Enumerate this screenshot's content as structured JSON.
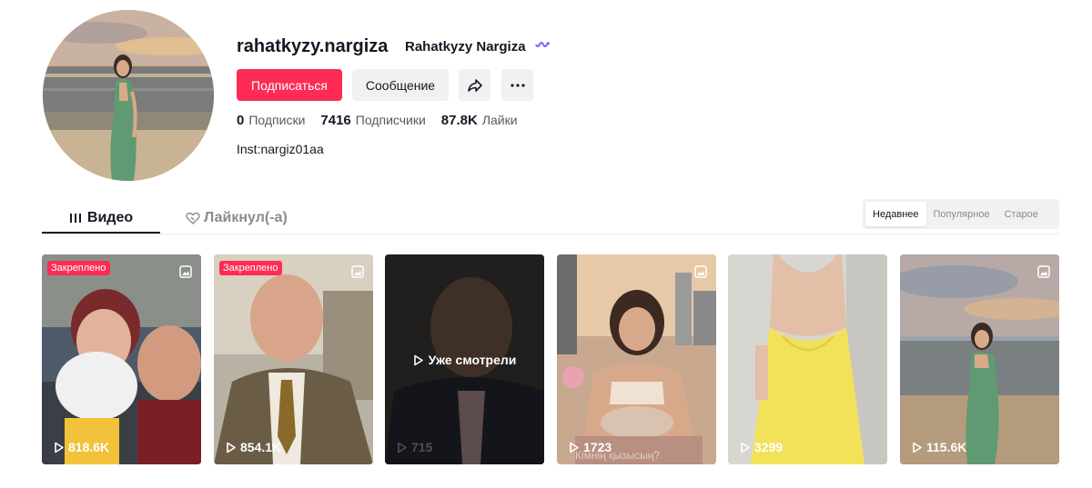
{
  "profile": {
    "username": "rahatkyzy.nargiza",
    "nickname": "Rahatkyzy Nargiza",
    "bio": "Inst:nargiz01aa",
    "avatar_icon": "avatar-photo"
  },
  "actions": {
    "follow_label": "Подписаться",
    "message_label": "Сообщение",
    "share_icon": "share-icon",
    "more_icon": "more-icon"
  },
  "stats": [
    {
      "value": "0",
      "label": "Подписки"
    },
    {
      "value": "7416",
      "label": "Подписчики"
    },
    {
      "value": "87.8K",
      "label": "Лайки"
    }
  ],
  "tabs": [
    {
      "label": "Видео",
      "icon": "grid-icon",
      "active": true
    },
    {
      "label": "Лайкнул(-а)",
      "icon": "liked-heart-icon",
      "active": false
    }
  ],
  "sort": {
    "options": [
      "Недавнее",
      "Популярное",
      "Старое"
    ],
    "selected": "Недавнее"
  },
  "videos": [
    {
      "views": "818.6K",
      "pinned": "Закреплено",
      "photo": true,
      "watched": false
    },
    {
      "views": "854.1K",
      "pinned": "Закреплено",
      "photo": true,
      "watched": false
    },
    {
      "views": "715",
      "watched": true,
      "watched_label": "Уже смотрели"
    },
    {
      "views": "1723",
      "photo": true,
      "watched": false,
      "caption": "Кімнің қызысың?"
    },
    {
      "views": "3299",
      "watched": false
    },
    {
      "views": "115.6K",
      "photo": true,
      "watched": false
    }
  ],
  "colors": {
    "accent": "#fe2c55",
    "text": "#161823",
    "muted": "#8a8b91",
    "button_bg": "#f1f1f2",
    "wave": "#7b61ff"
  }
}
